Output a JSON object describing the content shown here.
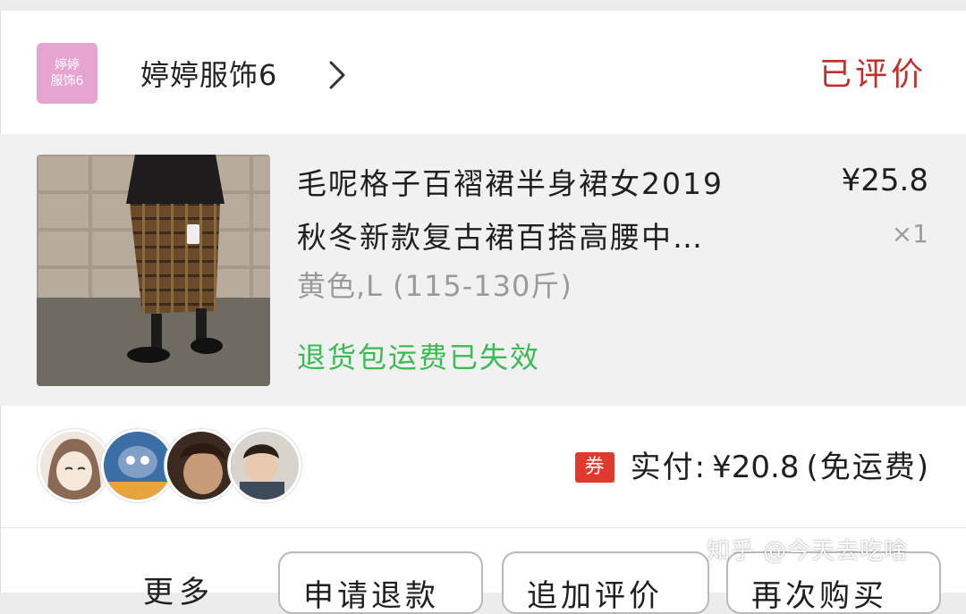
{
  "store": {
    "logo_line1": "婷婷",
    "logo_line2": "服饰6",
    "name": "婷婷服饰6",
    "status": "已评价"
  },
  "product": {
    "title_line1": "毛呢格子百褶裙半身裙女2019",
    "title_line2": "秋冬新款复古裙百搭高腰中…",
    "price": "¥25.8",
    "quantity": "×1",
    "sku": "黄色,L (115-130斤)",
    "shipping_note": "退货包运费已失效"
  },
  "avatars": [
    {
      "name": "avatar-girl-illustration"
    },
    {
      "name": "avatar-tom-cat"
    },
    {
      "name": "avatar-child-portrait"
    },
    {
      "name": "avatar-toddler-photo"
    }
  ],
  "payment": {
    "coupon_badge": "券",
    "paid_label": "实付:",
    "paid_amount": "¥20.8",
    "paid_note": "(免运费)"
  },
  "actions": {
    "more_label": "更多",
    "buttons": [
      "申请退款",
      "追加评价",
      "再次购买"
    ]
  },
  "watermark": "知乎 @今天去吃啥",
  "colors": {
    "status_red": "#c2302b",
    "shipping_green": "#3cba54",
    "coupon_red": "#e03a2f",
    "logo_pink": "#e7a4d2"
  }
}
